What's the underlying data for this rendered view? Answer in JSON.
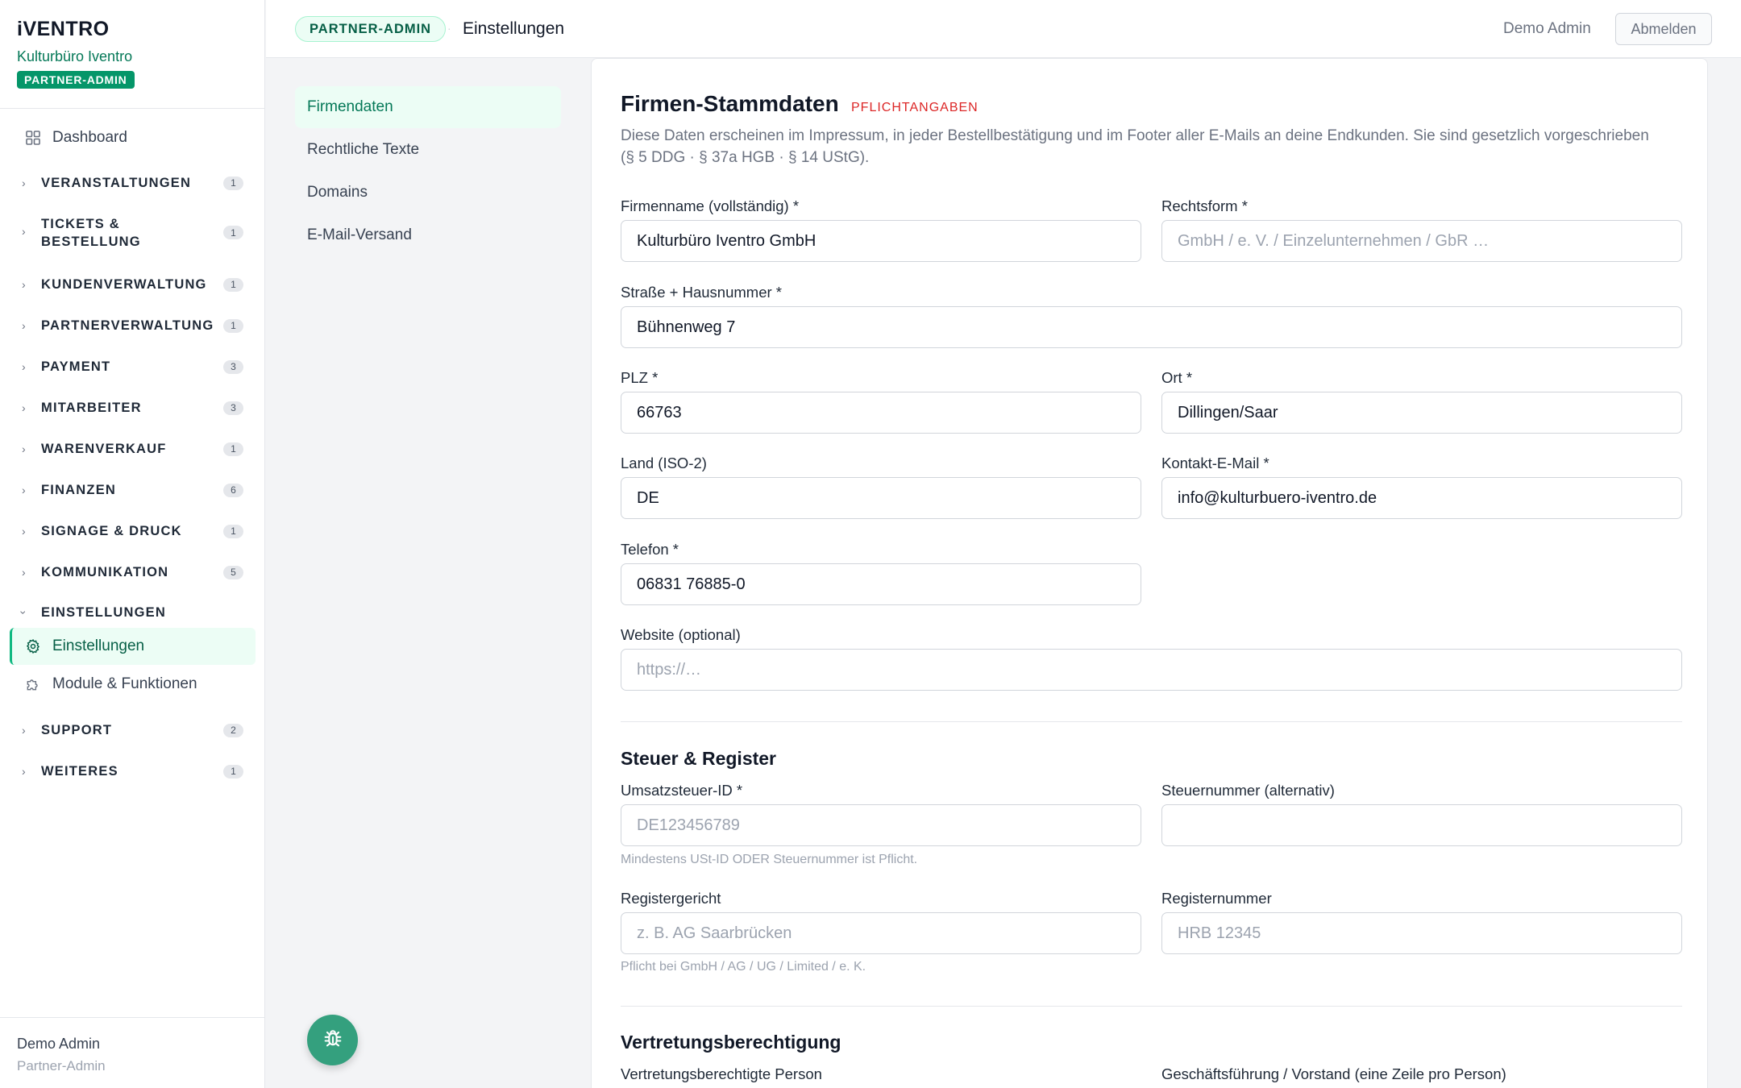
{
  "brand": {
    "logo": "iVENTRO",
    "org": "Kulturbüro Iventro",
    "role": "PARTNER-ADMIN"
  },
  "nav": {
    "dashboard": "Dashboard",
    "groups": [
      {
        "label": "VERANSTALTUNGEN",
        "count": "1"
      },
      {
        "label": "TICKETS &\nBESTELLUNG",
        "count": "1"
      },
      {
        "label": "KUNDENVERWALTUNG",
        "count": "1"
      },
      {
        "label": "PARTNERVERWALTUNG",
        "count": "1"
      },
      {
        "label": "PAYMENT",
        "count": "3"
      },
      {
        "label": "MITARBEITER",
        "count": "3"
      },
      {
        "label": "WARENVERKAUF",
        "count": "1"
      },
      {
        "label": "FINANZEN",
        "count": "6"
      },
      {
        "label": "SIGNAGE & DRUCK",
        "count": "1"
      },
      {
        "label": "KOMMUNIKATION",
        "count": "5"
      },
      {
        "label": "EINSTELLUNGEN",
        "count": ""
      },
      {
        "label": "SUPPORT",
        "count": "2"
      },
      {
        "label": "WEITERES",
        "count": "1"
      }
    ],
    "settings_items": [
      "Einstellungen",
      "Module & Funktionen"
    ]
  },
  "sidebar_footer": {
    "name": "Demo Admin",
    "role": "Partner-Admin"
  },
  "topbar": {
    "role_pill": "PARTNER-ADMIN",
    "page": "Einstellungen",
    "user": "Demo Admin",
    "logout": "Abmelden"
  },
  "subnav": [
    "Firmendaten",
    "Rechtliche Texte",
    "Domains",
    "E-Mail-Versand"
  ],
  "form": {
    "title": "Firmen-Stammdaten",
    "required_tag": "PFLICHTANGABEN",
    "description": "Diese Daten erscheinen im Impressum, in jeder Bestellbestätigung und im Footer aller E-Mails an deine Endkunden. Sie sind gesetzlich vorgeschrieben (§ 5 DDG · § 37a HGB · § 14 UStG).",
    "company_name": {
      "label": "Firmenname (vollständig) *",
      "value": "Kulturbüro Iventro GmbH"
    },
    "legal_form": {
      "label": "Rechtsform *",
      "placeholder": "GmbH / e. V. / Einzelunternehmen / GbR …"
    },
    "street": {
      "label": "Straße + Hausnummer *",
      "value": "Bühnenweg 7"
    },
    "zip": {
      "label": "PLZ *",
      "value": "66763"
    },
    "city": {
      "label": "Ort *",
      "value": "Dillingen/Saar"
    },
    "country": {
      "label": "Land (ISO-2)",
      "value": "DE"
    },
    "email": {
      "label": "Kontakt-E-Mail *",
      "value": "info@kulturbuero-iventro.de"
    },
    "phone": {
      "label": "Telefon *",
      "value": "06831 76885-0"
    },
    "website": {
      "label": "Website (optional)",
      "placeholder": "https://…"
    },
    "tax_section": "Steuer & Register",
    "vat_id": {
      "label": "Umsatzsteuer-ID *",
      "placeholder": "DE123456789"
    },
    "tax_number": {
      "label": "Steuernummer (alternativ)",
      "placeholder": ""
    },
    "tax_hint": "Mindestens USt-ID ODER Steuernummer ist Pflicht.",
    "court": {
      "label": "Registergericht",
      "placeholder": "z. B. AG Saarbrücken"
    },
    "reg_number": {
      "label": "Registernummer",
      "placeholder": "HRB 12345"
    },
    "reg_hint": "Pflicht bei GmbH / AG / UG / Limited / e. K.",
    "rep_section": "Vertretungsberechtigung",
    "rep_person": {
      "label": "Vertretungsberechtigte Person"
    },
    "management": {
      "label": "Geschäftsführung / Vorstand (eine Zeile pro Person)"
    }
  },
  "colors": {
    "accent": "#059669",
    "accent_light": "#ecfdf5",
    "danger": "#dc2626"
  }
}
